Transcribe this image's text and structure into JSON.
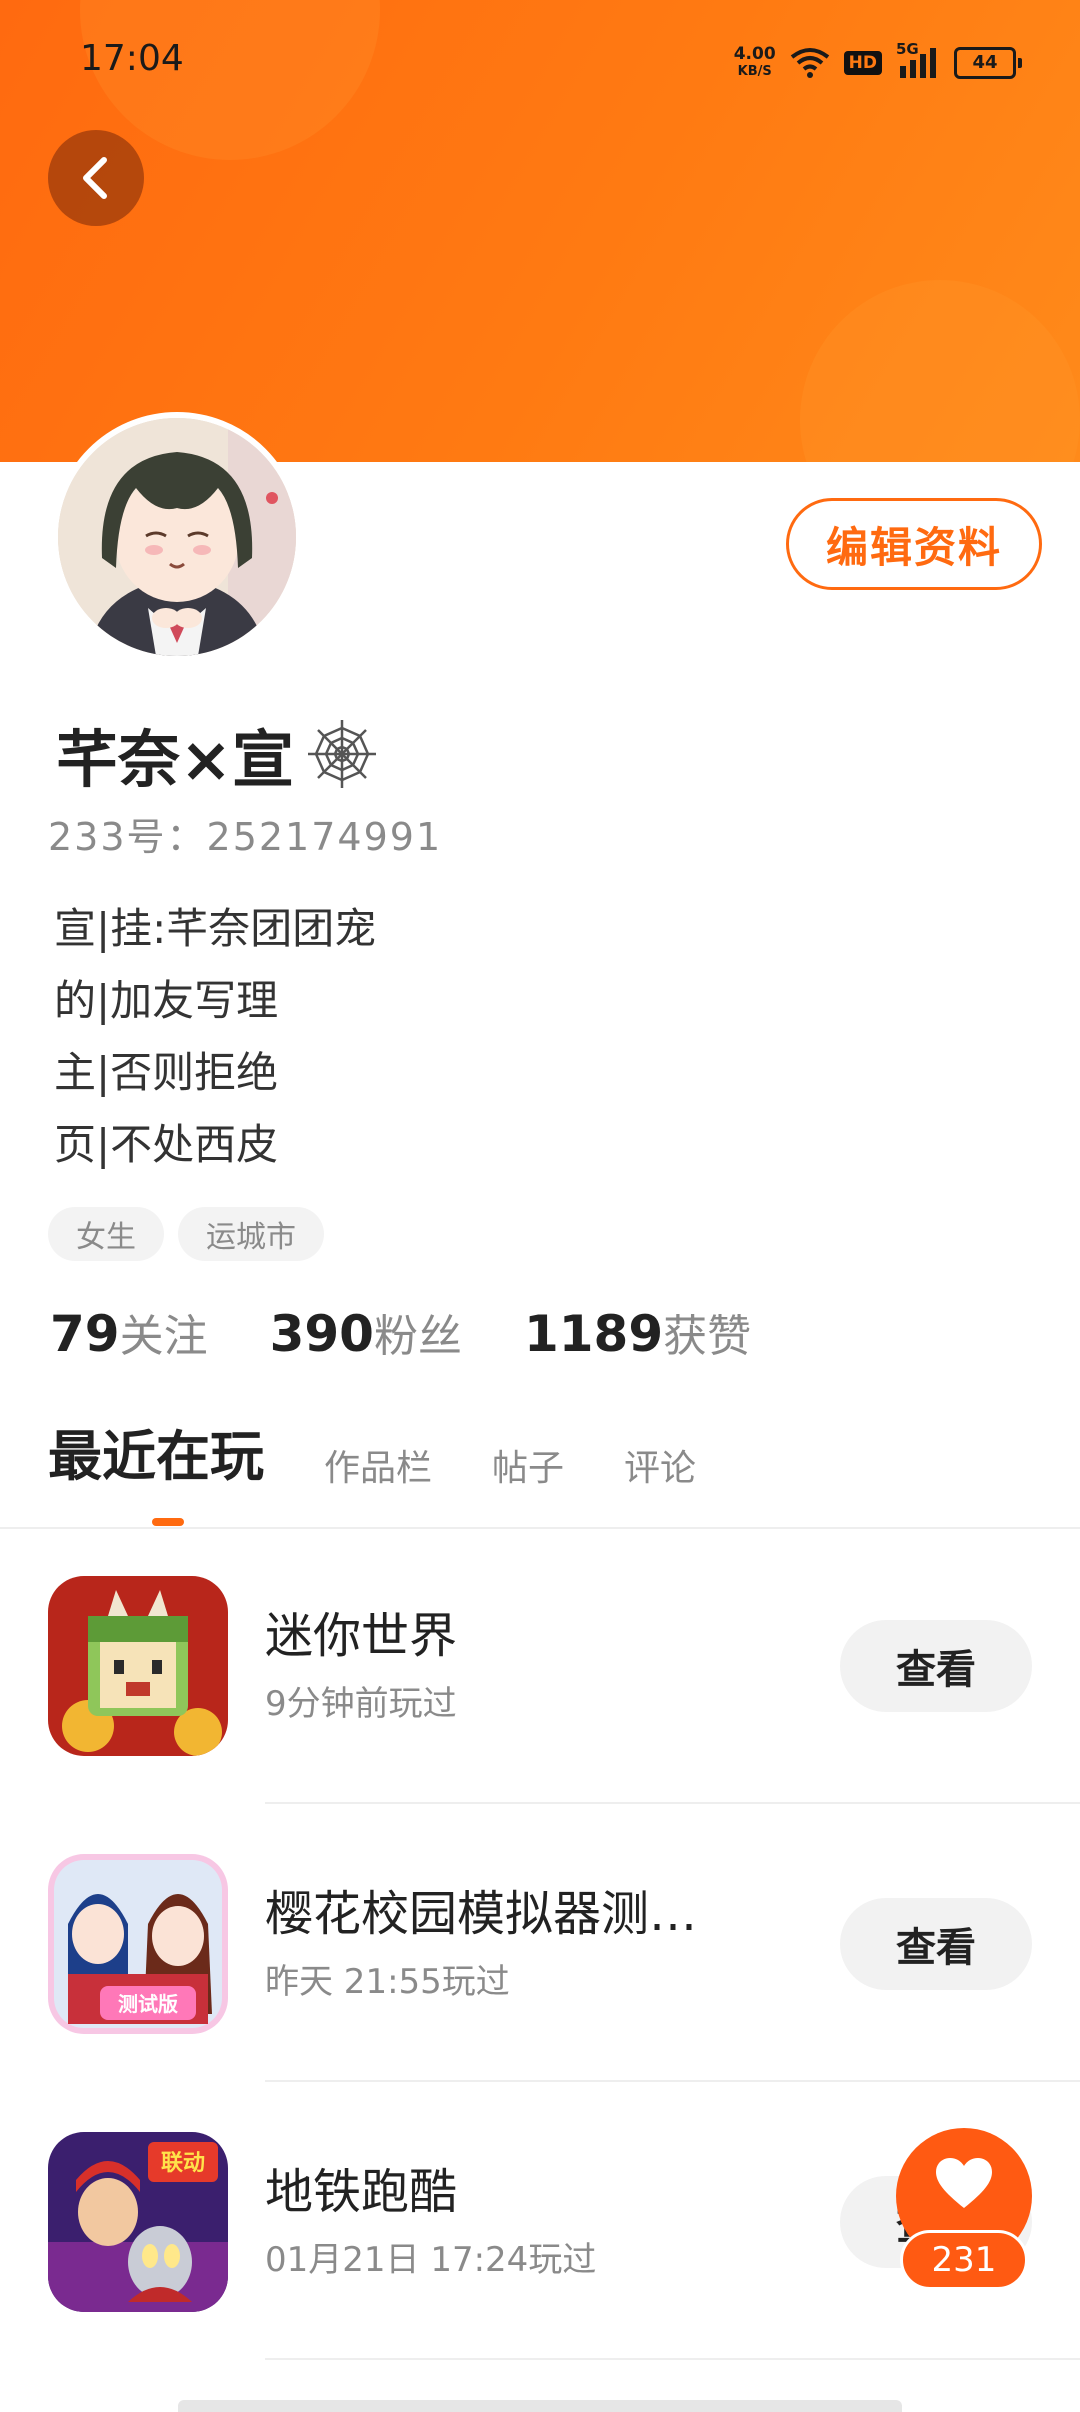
{
  "status_bar": {
    "time": "17:04",
    "net_speed_value": "4.00",
    "net_speed_unit": "KB/S",
    "hd_label": "HD",
    "network_label": "5G",
    "battery_level": "44"
  },
  "theme": {
    "accent": "#ff6a10",
    "banner": "#ff7a12"
  },
  "profile": {
    "nickname": "芊奈×宣",
    "uid": "233号：252174991",
    "edit_label": "编辑资料",
    "bio_lines": [
      "宣|挂:芊奈团团宠",
      "的|加友写理",
      "主|否则拒绝",
      "页|不处西皮"
    ],
    "tags": [
      "女生",
      "运城市"
    ],
    "stats": [
      {
        "num": "79",
        "label": "关注"
      },
      {
        "num": "390",
        "label": "粉丝"
      },
      {
        "num": "1189",
        "label": "获赞"
      }
    ]
  },
  "tabs": [
    "最近在玩",
    "作品栏",
    "帖子",
    "评论"
  ],
  "games": [
    {
      "title": "迷你世界",
      "time": "9分钟前玩过",
      "button": "查看",
      "icon": "mini-world-icon"
    },
    {
      "title": "樱花校园模拟器测…",
      "time": "昨天 21:55玩过",
      "button": "查看",
      "icon": "sakura-school-icon"
    },
    {
      "title": "地铁跑酷",
      "time": "01月21日 17:24玩过",
      "button": "查看",
      "icon": "subway-surfers-icon"
    }
  ],
  "like_fab": {
    "count": "231"
  }
}
